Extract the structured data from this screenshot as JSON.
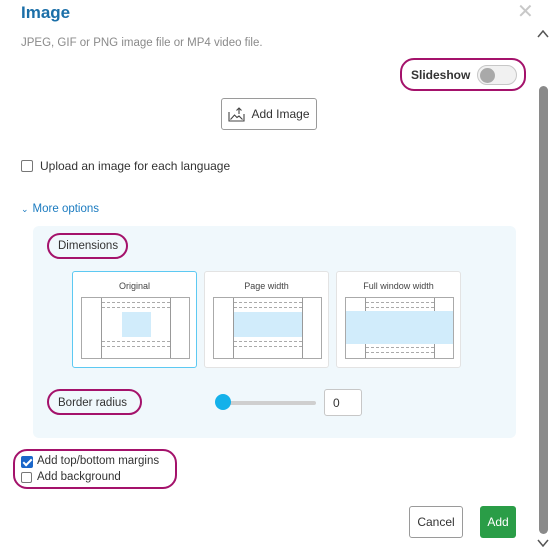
{
  "dialog": {
    "title": "Image",
    "close_glyph": "✕",
    "subtitle": "JPEG, GIF or PNG image file or MP4 video file."
  },
  "slideshow": {
    "label": "Slideshow",
    "enabled": false
  },
  "add_image": {
    "label": "Add Image",
    "icon": "add-image-icon"
  },
  "upload_per_language": {
    "label": "Upload an image for each language",
    "checked": false
  },
  "more_options": {
    "label": "More options",
    "expanded": true
  },
  "dimensions": {
    "label": "Dimensions",
    "options": [
      {
        "label": "Original",
        "selected": true
      },
      {
        "label": "Page width",
        "selected": false
      },
      {
        "label": "Full window width",
        "selected": false
      }
    ]
  },
  "border_radius": {
    "label": "Border radius",
    "value": "0"
  },
  "margins": {
    "label": "Add top/bottom margins",
    "checked": true
  },
  "background": {
    "label": "Add background",
    "checked": false
  },
  "footer": {
    "cancel_label": "Cancel",
    "add_label": "Add"
  },
  "colors": {
    "title": "#1b6fa8",
    "highlight": "#a4126b",
    "primary_button": "#2a9d47",
    "accent": "#14b1ea",
    "panel": "#f0f8fc"
  }
}
